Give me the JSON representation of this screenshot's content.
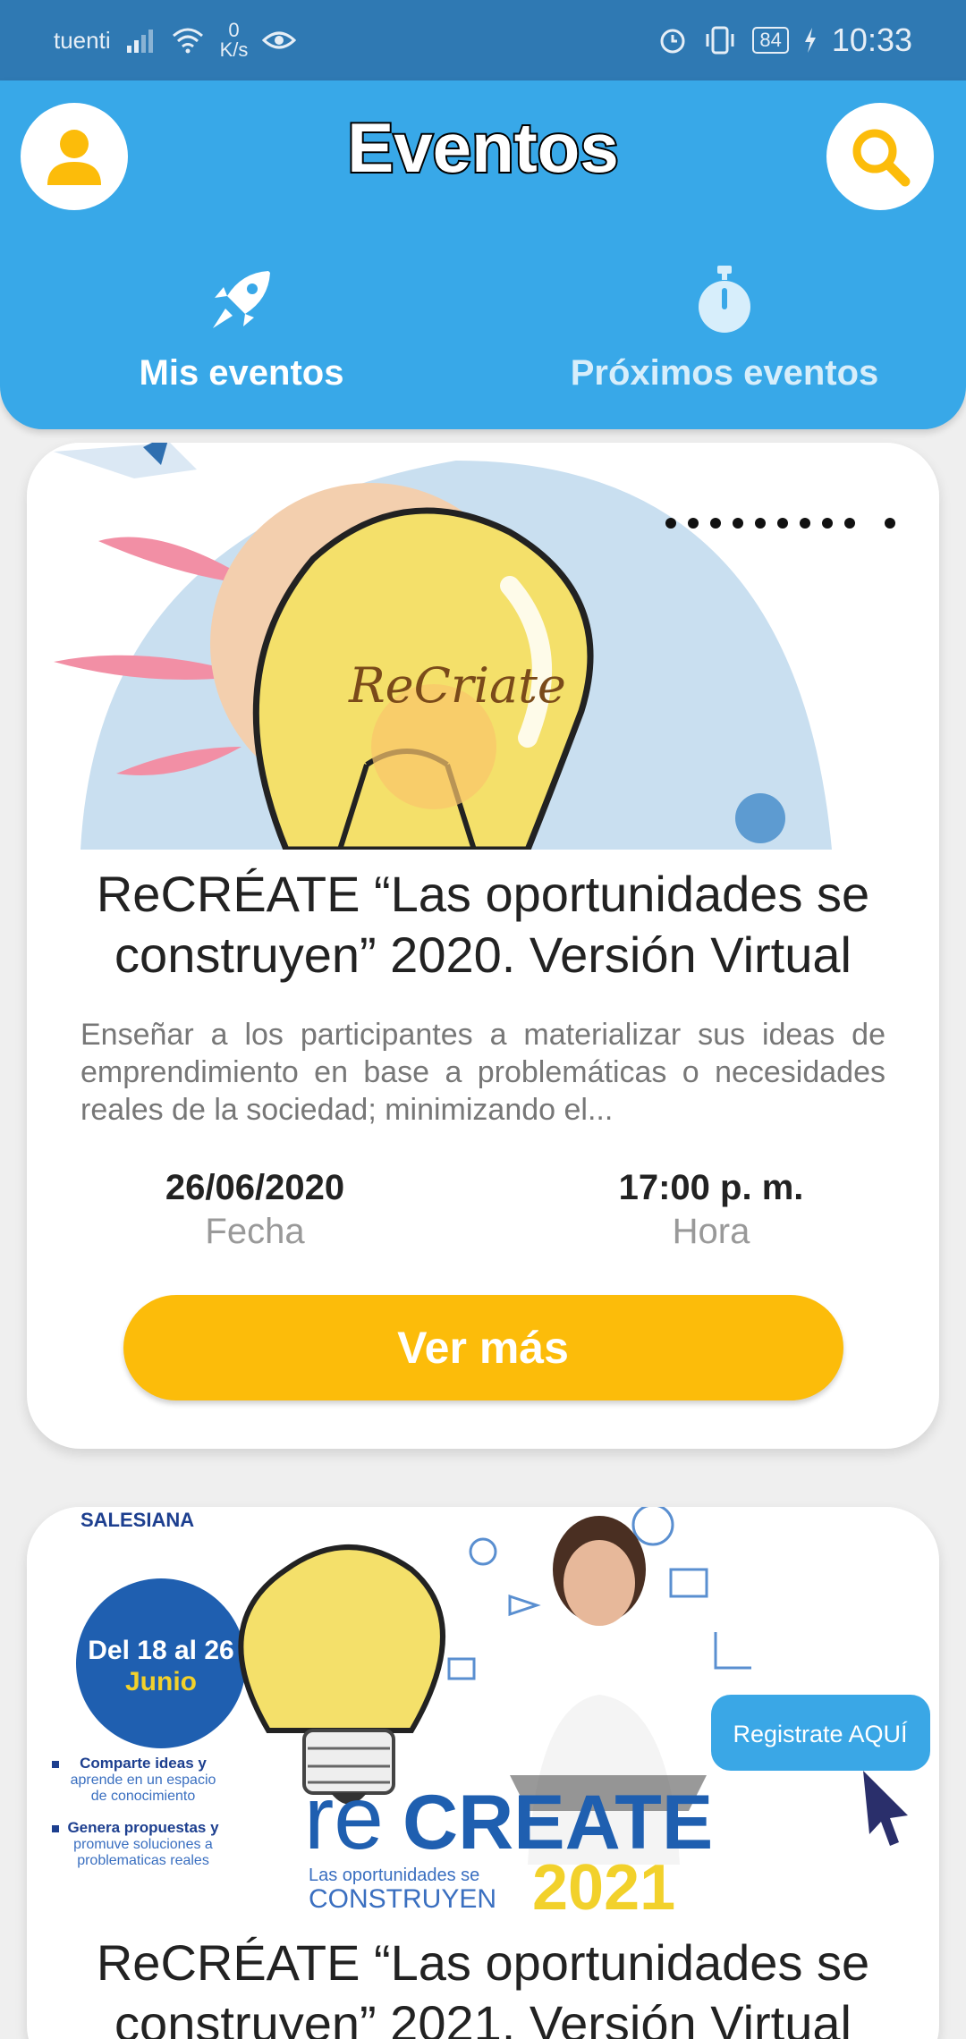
{
  "status_bar": {
    "carrier": "tuenti",
    "net_speed_value": "0",
    "net_speed_unit": "K/s",
    "battery": "84",
    "time": "10:33"
  },
  "header": {
    "title": "Eventos",
    "tabs": [
      {
        "label": "Mis eventos",
        "icon": "rocket-icon"
      },
      {
        "label": "Próximos eventos",
        "icon": "stopwatch-icon"
      }
    ]
  },
  "events": [
    {
      "image_text": "ReCriate",
      "title": "ReCRÉATE “Las oportunidades se construyen” 2020. Versión Virtual",
      "description": "Enseñar a los participantes a materializar sus ideas de emprendimiento en base a problemáticas o necesidades reales de la sociedad; minimizando el...",
      "date": "26/06/2020",
      "date_label": "Fecha",
      "time": "17:00 p. m.",
      "time_label": "Hora",
      "button": "Ver más"
    },
    {
      "image_text": {
        "org": "SALESIANA",
        "dates_a": "Del 18 al 26",
        "dates_b": "Junio",
        "bullet1a": "Comparte ideas y",
        "bullet1b": "aprende en un espacio",
        "bullet1c": "de conocimiento",
        "bullet2a": "Genera propuestas y",
        "bullet2b": "promuve soluciones a",
        "bullet2c": "problematicas reales",
        "brand_a": "re",
        "brand_b": "CREATE",
        "tagline_a": "Las oportunidades se",
        "tagline_b": "CONSTRUYEN",
        "year": "2021",
        "cta": "Registrate AQUÍ"
      },
      "title": "ReCRÉATE “Las oportunidades se construyen” 2021. Versión Virtual"
    }
  ],
  "colors": {
    "status_bar": "#2f79b3",
    "header": "#38a8e8",
    "accent": "#fcbc0a",
    "card": "#ffffff",
    "background": "#efefef"
  }
}
